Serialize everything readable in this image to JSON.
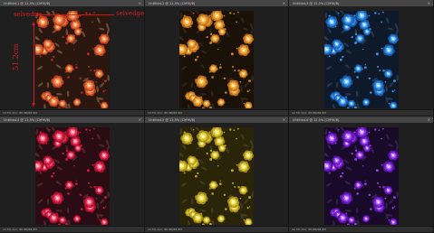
{
  "documents": [
    {
      "title": "Untitled-1 @ 12.5% (CMYK/8)",
      "status": "12.5%   Doc: 68.8M/68.8M",
      "palette": {
        "bg": "#2a1710",
        "petal1": "#e8722e",
        "petal2": "#f2a46a",
        "petal3": "#c2422a",
        "center": "#fbe0b8",
        "leaf": "#7a5a3a",
        "dot": "#b8301e"
      },
      "annotations": {
        "selvedge_left": "selvedge",
        "selvedge_right": "selvedge",
        "height_label": "51.2cm"
      }
    },
    {
      "title": "Untitled-2 @ 12.5% (CMYK/8)",
      "status": "12.5%   Doc: 68.8M/68.8M",
      "palette": {
        "bg": "#1a1208",
        "petal1": "#e89a2a",
        "petal2": "#f5c25a",
        "petal3": "#c2701e",
        "center": "#fff0c0",
        "leaf": "#3a2a1a",
        "dot": "#d08a20"
      }
    },
    {
      "title": "Untitled-3 @ 12.5% (CMYK/8)",
      "status": "12.5%   Doc: 68.8M/68.8M",
      "palette": {
        "bg": "#0e1a2a",
        "petal1": "#2a8ae0",
        "petal2": "#7ac8ff",
        "petal3": "#1a5ab0",
        "center": "#d8f2ff",
        "leaf": "#2a3e5a",
        "dot": "#3aa0f0"
      }
    },
    {
      "title": "Untitled-4 @ 12.5% (CMYK/8)",
      "status": "12.5%   Doc: 68.8M/68.8M",
      "palette": {
        "bg": "#2a0c14",
        "petal1": "#e0284e",
        "petal2": "#ff7a96",
        "petal3": "#b0102e",
        "center": "#ffd0dc",
        "leaf": "#5a2a30",
        "dot": "#d0203e"
      }
    },
    {
      "title": "Untitled-5 @ 12.5% (CMYK/8)",
      "status": "12.5%   Doc: 68.8M/68.8M",
      "palette": {
        "bg": "#2a2408",
        "petal1": "#d8c02a",
        "petal2": "#f5e66a",
        "petal3": "#a8901a",
        "center": "#fffbd0",
        "leaf": "#4a4020",
        "dot": "#c8b020"
      }
    },
    {
      "title": "Untitled-6 @ 12.5% (CMYK/8)",
      "status": "12.5%   Doc: 68.8M/68.8M",
      "palette": {
        "bg": "#1a0a2a",
        "petal1": "#8a2ae0",
        "petal2": "#c07aff",
        "petal3": "#5a12b0",
        "center": "#ecd8ff",
        "leaf": "#3a2458",
        "dot": "#a040f0"
      }
    }
  ],
  "icons": {
    "close": "close-icon"
  },
  "colors": {
    "annotation": "#d21a1a",
    "workspace": "#3a3a3a"
  }
}
